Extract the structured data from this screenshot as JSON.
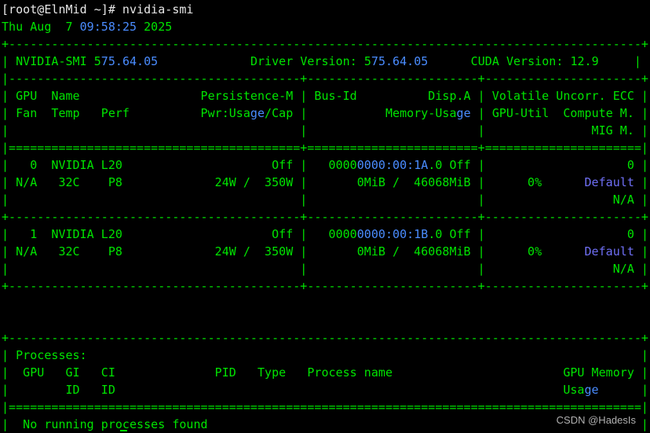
{
  "terminal": {
    "lines": [
      [
        {
          "t": "[root@ElnMid ~]# nvidia-smi",
          "c": "w"
        }
      ],
      [
        {
          "t": "Thu Aug  7 ",
          "c": "g"
        },
        {
          "t": "09:58:25",
          "c": "b"
        },
        {
          "t": " 2025",
          "c": "g"
        }
      ],
      [
        {
          "t": "+-----------------------------------------------------------------------------------------+",
          "c": "g"
        }
      ],
      [
        {
          "t": "| NVIDIA-SMI 5",
          "c": "g"
        },
        {
          "t": "75.64.05",
          "c": "b"
        },
        {
          "t": "             Driver Version: 5",
          "c": "g"
        },
        {
          "t": "75.64.05",
          "c": "b"
        },
        {
          "t": "      CUDA Version: 12.9     |",
          "c": "g"
        }
      ],
      [
        {
          "t": "|-----------------------------------------+------------------------+----------------------+",
          "c": "g"
        }
      ],
      [
        {
          "t": "| GPU  Name                 Persistence-M | Bus-Id          Disp.A | Volatile Uncorr. ECC |",
          "c": "g"
        }
      ],
      [
        {
          "t": "| Fan  Temp   Perf          Pwr:Usa",
          "c": "g"
        },
        {
          "t": "ge",
          "c": "b"
        },
        {
          "t": "/Cap |           Memory-Usa",
          "c": "g"
        },
        {
          "t": "ge",
          "c": "b"
        },
        {
          "t": " | GPU-Util  Compute M. |",
          "c": "g"
        }
      ],
      [
        {
          "t": "|                                         |                        |               MIG M. |",
          "c": "g"
        }
      ],
      [
        {
          "t": "|=========================================+========================+======================|",
          "c": "g"
        }
      ],
      [
        {
          "t": "|   0  NVIDIA L20                     Off |   0000",
          "c": "g"
        },
        {
          "t": "0000:00:1A",
          "c": "b"
        },
        {
          "t": ".0 Off |                    0 |",
          "c": "g"
        }
      ],
      [
        {
          "t": "| N/A   32C    P8             24W /  350W |       0MiB /  46068MiB |      0%      ",
          "c": "g"
        },
        {
          "t": "Default",
          "c": "p"
        },
        {
          "t": " |",
          "c": "g"
        }
      ],
      [
        {
          "t": "|                                         |                        |                  N/A |",
          "c": "g"
        }
      ],
      [
        {
          "t": "+-----------------------------------------+------------------------+----------------------+",
          "c": "g"
        }
      ],
      [
        {
          "t": "|   1  NVIDIA L20                     Off |   0000",
          "c": "g"
        },
        {
          "t": "0000:00:1B",
          "c": "b"
        },
        {
          "t": ".0 Off |                    0 |",
          "c": "g"
        }
      ],
      [
        {
          "t": "| N/A   32C    P8             24W /  350W |       0MiB /  46068MiB |      0%      ",
          "c": "g"
        },
        {
          "t": "Default",
          "c": "p"
        },
        {
          "t": " |",
          "c": "g"
        }
      ],
      [
        {
          "t": "|                                         |                        |                  N/A |",
          "c": "g"
        }
      ],
      [
        {
          "t": "+-----------------------------------------+------------------------+----------------------+",
          "c": "g"
        }
      ],
      [],
      [],
      [
        {
          "t": "+-----------------------------------------------------------------------------------------+",
          "c": "g"
        }
      ],
      [
        {
          "t": "| Processes:                                                                              |",
          "c": "g"
        }
      ],
      [
        {
          "t": "|  GPU   GI   CI              PID   Type   Process name                        GPU Memory |",
          "c": "g"
        }
      ],
      [
        {
          "t": "|        ID   ID                                                               Usa",
          "c": "g"
        },
        {
          "t": "ge",
          "c": "b"
        },
        {
          "t": "      |",
          "c": "g"
        }
      ],
      [
        {
          "t": "|=========================================================================================|",
          "c": "g"
        }
      ],
      [
        {
          "t": "|  No running processes found                                                             |",
          "c": "g"
        }
      ],
      [
        {
          "t": "+-----------------------------------------------------------------------------------------+",
          "c": "g"
        }
      ]
    ]
  },
  "watermark": "CSDN @HadesIs",
  "colors": {
    "background": "#000000",
    "text_green": "#00e400",
    "text_white": "#e8e8e8",
    "text_blue": "#4a8cff",
    "text_purple": "#6f6ff5"
  }
}
